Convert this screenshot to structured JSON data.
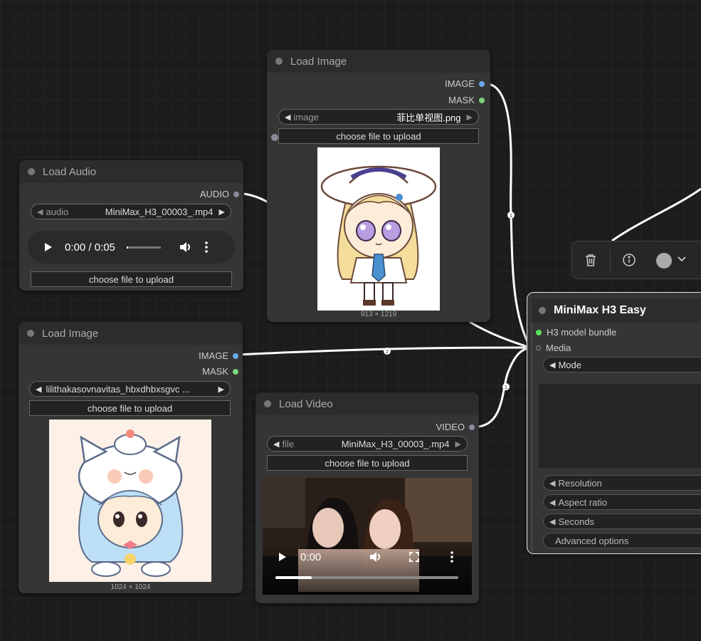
{
  "nodes": {
    "load_image_top": {
      "title": "Load Image",
      "outputs": [
        "IMAGE",
        "MASK"
      ],
      "widget": {
        "label": "image",
        "value": "菲比单视图.png"
      },
      "upload_label": "choose file to upload",
      "dims": "913 × 1219"
    },
    "load_audio": {
      "title": "Load Audio",
      "output": "AUDIO",
      "widget": {
        "label": "audio",
        "value": "MiniMax_H3_00003_.mp4"
      },
      "player": {
        "time": "0:00 / 0:05",
        "progress": 0.0
      },
      "upload_label": "choose file to upload"
    },
    "load_image_left": {
      "title": "Load Image",
      "outputs": [
        "IMAGE",
        "MASK"
      ],
      "widget": {
        "value": "lilithakasovnavitas_hbxdhbxsgvc ..."
      },
      "upload_label": "choose file to upload",
      "dims": "1024 × 1024"
    },
    "load_video": {
      "title": "Load Video",
      "output": "VIDEO",
      "widget": {
        "label": "file",
        "value": "MiniMax_H3_00003_.mp4"
      },
      "upload_label": "choose file to upload",
      "player": {
        "time": "0:00",
        "progress": 0.2
      }
    },
    "minimax": {
      "title": "MiniMax H3 Easy",
      "inputs": [
        "H3 model bundle",
        "Media"
      ],
      "mode": "Mode",
      "options": [
        "Resolution",
        "Aspect ratio",
        "Seconds"
      ],
      "advanced": "Advanced options"
    }
  },
  "links": [
    {
      "label": "1"
    },
    {
      "label": "2"
    },
    {
      "label": "1"
    }
  ],
  "colors": {
    "image_pin": "#6aa8f0",
    "mask_pin": "#7dd47d",
    "model_pin": "#5be05b",
    "wire": "#ffffff"
  },
  "icons": [
    "trash-icon",
    "info-icon",
    "color-dot-icon",
    "chevron-down-icon",
    "play-icon",
    "volume-icon",
    "more-icon",
    "fullscreen-icon"
  ]
}
